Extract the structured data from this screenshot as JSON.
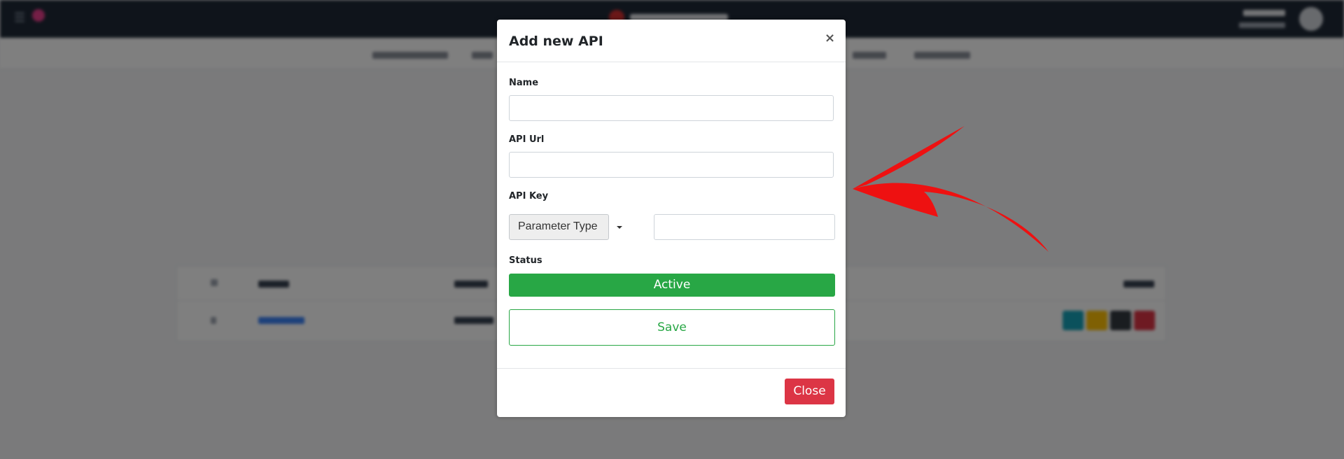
{
  "modal": {
    "title": "Add new API",
    "close_icon": "×",
    "fields": {
      "name_label": "Name",
      "name_value": "",
      "api_url_label": "API Url",
      "api_url_value": "",
      "api_key_label": "API Key",
      "api_key_value": "",
      "status_label": "Status"
    },
    "parameter_type": {
      "selected": "Parameter Type"
    },
    "status_button": "Active",
    "save_button": "Save",
    "close_button": "Close"
  },
  "colors": {
    "success": "#28a745",
    "danger": "#dc3545",
    "annotation_arrow": "#ee1111"
  },
  "icons": {
    "menu": "hamburger-icon",
    "close": "close-icon",
    "caret": "caret-down-icon",
    "annotation": "red-arrow-annotation"
  }
}
